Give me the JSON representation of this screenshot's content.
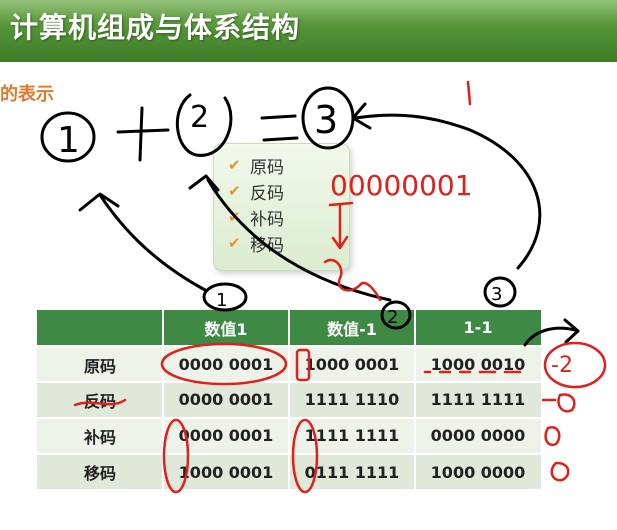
{
  "header": {
    "title": "计算机组成与体系结构"
  },
  "subtitle": "的表示",
  "legend": {
    "items": [
      "原码",
      "反码",
      "补码",
      "移码"
    ]
  },
  "table": {
    "headers": [
      "",
      "数值1",
      "数值-1",
      "1-1"
    ],
    "rows": [
      {
        "label": "原码",
        "cells": [
          "0000 0001",
          "1000 0001",
          "1000 0010"
        ]
      },
      {
        "label": "反码",
        "cells": [
          "0000 0001",
          "1111 1110",
          "1111 1111"
        ]
      },
      {
        "label": "补码",
        "cells": [
          "0000 0001",
          "1111 1111",
          "0000 0000"
        ]
      },
      {
        "label": "移码",
        "cells": [
          "1000 0001",
          "0111 1111",
          "1000 0000"
        ]
      }
    ]
  },
  "annotations": {
    "equation_left": "1",
    "equation_op": "+",
    "equation_right": "2",
    "equation_eq": "=",
    "equation_result": "3",
    "top_mark": "1",
    "binary": "00000001",
    "circled_1": "1",
    "circled_2": "2",
    "circled_3": "3",
    "result_neg2": "-2",
    "zero_1": "0",
    "zero_2": "0",
    "zero_3": "0"
  },
  "colors": {
    "header_bg": "#4f8f34",
    "table_header_bg": "#3e8a45",
    "row_light": "#eef3ea",
    "row_dark": "#dfe8d9",
    "subtitle": "#e0792b",
    "check": "#e8912c",
    "ink_black": "#000000",
    "ink_red": "#e0201a"
  }
}
